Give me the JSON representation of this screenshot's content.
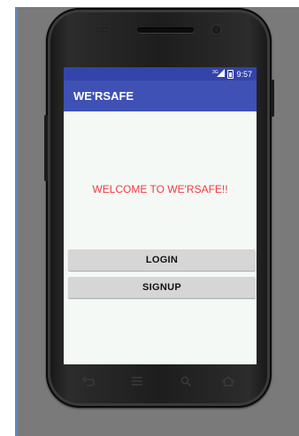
{
  "app": {
    "title": "WE'RSAFE",
    "welcome_text": "WELCOME TO WE'RSAFE!!"
  },
  "status_bar": {
    "time": "9:57",
    "signal_label": "3G",
    "signal_icon": "signal-icon",
    "battery_icon": "battery-icon"
  },
  "buttons": {
    "login_label": "LOGIN",
    "signup_label": "SIGNUP"
  },
  "nav": {
    "icons": [
      "back-icon",
      "menu-icon",
      "search-icon",
      "home-icon"
    ]
  },
  "colors": {
    "app_bar": "#3f51b5",
    "status_bar": "#3344aa",
    "welcome_text": "#f03c3c",
    "screen_background": "#f5f9f6",
    "button_background": "#d6d6d6"
  }
}
